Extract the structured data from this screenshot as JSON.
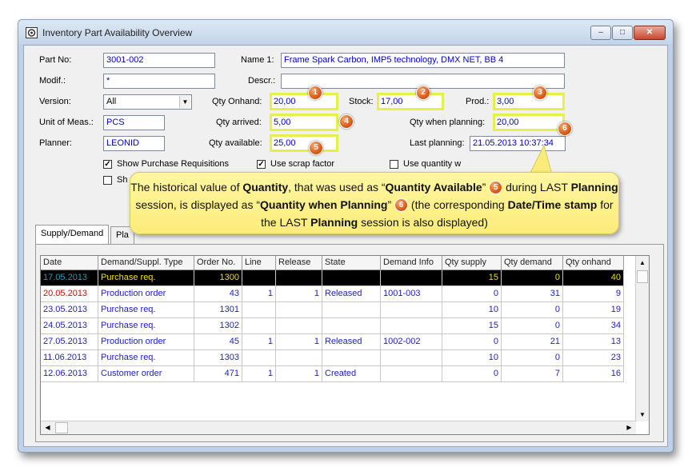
{
  "window": {
    "title": "Inventory Part Availability Overview",
    "controls": {
      "minimize": "–",
      "maximize": "□",
      "close": "✕"
    }
  },
  "form": {
    "part_no_label": "Part No:",
    "part_no": "3001-002",
    "name1_label": "Name 1:",
    "name1": "Frame Spark Carbon, IMP5 technology, DMX NET, BB 4",
    "modif_label": "Modif.:",
    "modif": "*",
    "descr_label": "Descr.:",
    "descr": "",
    "version_label": "Version:",
    "version": "All",
    "qty_onhand_label": "Qty Onhand:",
    "qty_onhand": "20,00",
    "stock_label": "Stock:",
    "stock": "17,00",
    "prod_label": "Prod.:",
    "prod": "3,00",
    "uom_label": "Unit of Meas.:",
    "uom": "PCS",
    "qty_arrived_label": "Qty arrived:",
    "qty_arrived": "5,00",
    "qty_when_planning_label": "Qty when planning:",
    "qty_when_planning": "20,00",
    "planner_label": "Planner:",
    "planner": "LEONID",
    "qty_available_label": "Qty available:",
    "qty_available": "25,00",
    "last_planning_label": "Last planning:",
    "last_planning": "21.05.2013 10:37:34"
  },
  "checkboxes": {
    "show_purchase_requisitions": {
      "label": "Show Purchase Requisitions",
      "checked": true
    },
    "use_scrap_factor": {
      "label": "Use scrap factor",
      "checked": true
    },
    "use_quantity": {
      "label": "Use quantity w",
      "checked": false
    },
    "second_row": {
      "label": "Sh",
      "checked": false
    }
  },
  "badges": [
    "1",
    "2",
    "3",
    "4",
    "5",
    "6"
  ],
  "tabs": [
    "Supply/Demand",
    "Pla"
  ],
  "table": {
    "columns": [
      "Date",
      "Demand/Suppl. Type",
      "Order No.",
      "Line",
      "Release",
      "State",
      "Demand Info",
      "Qty supply",
      "Qty demand",
      "Qty onhand"
    ],
    "rows": [
      {
        "date": "17.05.2013",
        "type": "Purchase req.",
        "order_no": "1300",
        "line": "",
        "release": "",
        "state": "",
        "demand_info": "",
        "qty_supply": "15",
        "qty_demand": "0",
        "qty_onhand": "40"
      },
      {
        "date": "20.05.2013",
        "type": "Production order",
        "order_no": "43",
        "line": "1",
        "release": "1",
        "state": "Released",
        "demand_info": "1001-003",
        "qty_supply": "0",
        "qty_demand": "31",
        "qty_onhand": "9"
      },
      {
        "date": "23.05.2013",
        "type": "Purchase req.",
        "order_no": "1301",
        "line": "",
        "release": "",
        "state": "",
        "demand_info": "",
        "qty_supply": "10",
        "qty_demand": "0",
        "qty_onhand": "19"
      },
      {
        "date": "24.05.2013",
        "type": "Purchase req.",
        "order_no": "1302",
        "line": "",
        "release": "",
        "state": "",
        "demand_info": "",
        "qty_supply": "15",
        "qty_demand": "0",
        "qty_onhand": "34"
      },
      {
        "date": "27.05.2013",
        "type": "Production order",
        "order_no": "45",
        "line": "1",
        "release": "1",
        "state": "Released",
        "demand_info": "1002-002",
        "qty_supply": "0",
        "qty_demand": "21",
        "qty_onhand": "13"
      },
      {
        "date": "11.06.2013",
        "type": "Purchase req.",
        "order_no": "1303",
        "line": "",
        "release": "",
        "state": "",
        "demand_info": "",
        "qty_supply": "10",
        "qty_demand": "0",
        "qty_onhand": "23"
      },
      {
        "date": "12.06.2013",
        "type": "Customer order",
        "order_no": "471",
        "line": "1",
        "release": "1",
        "state": "Created",
        "demand_info": "",
        "qty_supply": "0",
        "qty_demand": "7",
        "qty_onhand": "16"
      }
    ]
  },
  "callout": {
    "p1": "The historical value of ",
    "b1": "Quantity",
    "p2": ", that was used as “",
    "b2": "Quantity Available",
    "p3": "” ",
    "badge1": "5",
    "p4": " during LAST ",
    "b3": "Planning",
    "p5": " session, is displayed as “",
    "b4": "Quantity when Planning",
    "p6": "” ",
    "badge2": "6",
    "p7": " (the corresponding ",
    "b5": "Date/Time stamp",
    "p8": " for the LAST ",
    "b6": "Planning",
    "p9": " session is also displayed)"
  },
  "colors": {
    "highlight": "#e6f04a",
    "badge": "#e0601a",
    "callout": "#fbec7a",
    "selected_text": "#f0e000"
  }
}
